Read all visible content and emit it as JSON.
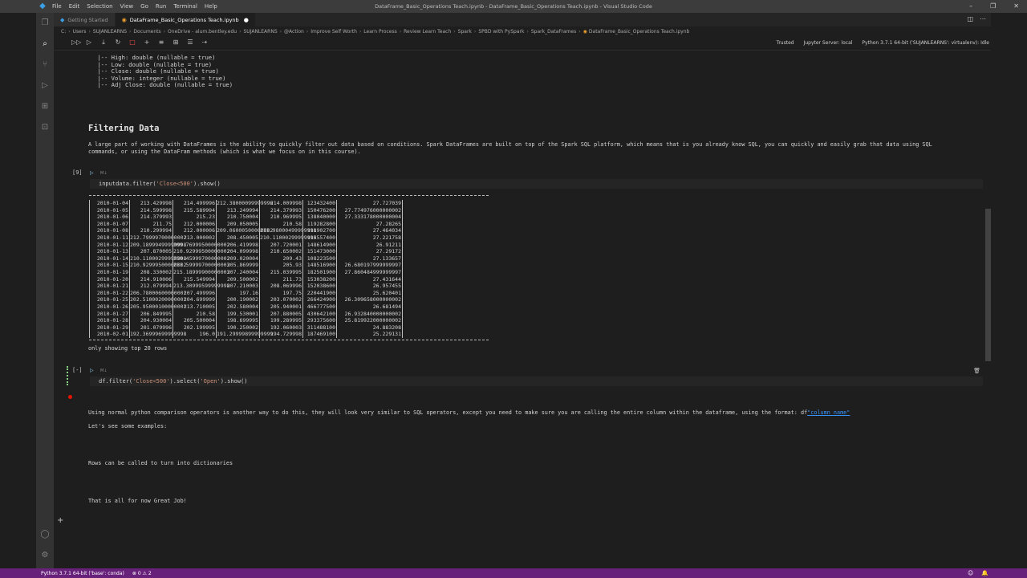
{
  "window": {
    "title": "DataFrame_Basic_Operations Teach.ipynb - DataFrame_Basic_Operations Teach.ipynb - Visual Studio Code",
    "menu": [
      "File",
      "Edit",
      "Selection",
      "View",
      "Go",
      "Run",
      "Terminal",
      "Help"
    ]
  },
  "tabs": [
    {
      "label": "Getting Started",
      "active": false
    },
    {
      "label": "DataFrame_Basic_Operations Teach.ipynb",
      "active": true,
      "dirty": "●"
    }
  ],
  "breadcrumb": [
    "C:",
    "Users",
    "SUJANLEARNS",
    "Documents",
    "OneDrive - alum.bentley.edu",
    "SUJANLEARNS",
    "@Action",
    "Improve Self Worth",
    "Learn Process",
    "Review Learn Teach",
    "Spark",
    "SPBD with PySpark",
    "Spark_DataFrames",
    "DataFrame_Basic_Operations Teach.ipynb"
  ],
  "toolbar": {
    "trusted": "Trusted",
    "jupyter_server": "Jupyter Server: local",
    "kernel": "Python 3.7.1 64-bit ('SUJANLEARNS': virtualenv): Idle"
  },
  "schema_lines": [
    " |-- High: double (nullable = true)",
    " |-- Low: double (nullable = true)",
    " |-- Close: double (nullable = true)",
    " |-- Volume: integer (nullable = true)",
    " |-- Adj Close: double (nullable = true)"
  ],
  "markdown1": {
    "heading": "Filtering Data",
    "line1": "A large part of working with DataFrames is the ability to quickly filter out data based on conditions. Spark DataFrames are built on top of the Spark SQL platform, which means that is you already know SQL, you can quickly and easily grab that data using SQL",
    "line2": "commands, or using the DataFram methods (which is what we focus on in this course)."
  },
  "cell1": {
    "count": "[9]",
    "lang": "M↓",
    "code_prefix": "inputdata.filter(",
    "code_str": "'Close<500'",
    "code_suffix": ").show()"
  },
  "output_rows": [
    [
      "2010-01-04",
      "213.429998",
      "214.499996",
      "212.38000099999996",
      "214.009998",
      "123432400",
      "27.727039"
    ],
    [
      "2010-01-05",
      "214.599998",
      "215.589994",
      "213.249994",
      "214.379993",
      "150476200",
      "27.774976000000002"
    ],
    [
      "2010-01-06",
      "214.379993",
      "215.23",
      "210.750004",
      "210.969995",
      "138040000",
      "27.333178000000004"
    ],
    [
      "2010-01-07",
      "211.75",
      "212.000006",
      "209.050005",
      "210.58",
      "119282800",
      "27.28265"
    ],
    [
      "2010-01-08",
      "210.299994",
      "212.000006",
      "209.06000500000002",
      "211.98000499999998",
      "111902700",
      "27.464034"
    ],
    [
      "2010-01-11",
      "212.79999700000002",
      "213.000002",
      "208.450005",
      "210.11000299999998",
      "115557400",
      "27.221758"
    ],
    [
      "2010-01-12",
      "209.18999499999998",
      "209.76999500000002",
      "206.419998",
      "207.720001",
      "148614900",
      "26.91211"
    ],
    [
      "2010-01-13",
      "207.870005",
      "210.92999500000002",
      "204.099998",
      "210.650002",
      "151473000",
      "27.29172"
    ],
    [
      "2010-01-14",
      "210.11000299999998",
      "210.45999700000002",
      "209.020004",
      "209.43",
      "108223500",
      "27.133657"
    ],
    [
      "2010-01-15",
      "210.92999500000002",
      "211.59999700000003",
      "205.869999",
      "205.93",
      "148516900",
      "26.680197999999997"
    ],
    [
      "2010-01-19",
      "208.330002",
      "215.18999900000003",
      "207.240004",
      "215.039995",
      "182501900",
      "27.860484999999997"
    ],
    [
      "2010-01-20",
      "214.910006",
      "215.549994",
      "209.500002",
      "211.73",
      "153038200",
      "27.431644"
    ],
    [
      "2010-01-21",
      "212.079994",
      "213.30999599999998",
      "207.210003",
      "208.069996",
      "152038600",
      "26.957455"
    ],
    [
      "2010-01-22",
      "206.78000600000001",
      "207.499996",
      "197.16",
      "197.75",
      "220441900",
      "25.620401"
    ],
    [
      "2010-01-25",
      "202.51000200000001",
      "204.699999",
      "200.190002",
      "203.070002",
      "266424900",
      "26.309658000000002"
    ],
    [
      "2010-01-26",
      "205.95000100000001",
      "213.710005",
      "202.580004",
      "205.940001",
      "466777500",
      "26.681494"
    ],
    [
      "2010-01-27",
      "206.849995",
      "210.58",
      "199.530001",
      "207.880005",
      "430642100",
      "26.932840000000002"
    ],
    [
      "2010-01-28",
      "204.930004",
      "205.500004",
      "198.699995",
      "199.289995",
      "293375600",
      "25.819922000000002"
    ],
    [
      "2010-01-29",
      "201.079996",
      "202.199995",
      "190.250002",
      "192.060003",
      "311488100",
      "24.883208"
    ],
    [
      "2010-02-01",
      "192.36999699999998",
      "196.0",
      "191.29999899999999",
      "194.729998",
      "187469100",
      "25.229131"
    ]
  ],
  "only_showing": "only showing top 20 rows",
  "cell2": {
    "count": "[-]",
    "lang": "M↓",
    "code_prefix": "df.filter(",
    "code_str1": "'Close<500'",
    "code_mid": ").select(",
    "code_str2": "'Open'",
    "code_suffix": ").show()"
  },
  "markdown2": {
    "text": "Using normal python comparison operators is another way to do this, they will look very similar to SQL operators, except you need to make sure you are calling the entire column within the dataframe, using the format: df",
    "link": "\"column name\"",
    "examples": "Let's see some examples:",
    "rows_dict": "Rows can be called to turn into dictionaries",
    "done": "That is all for now Great Job!"
  },
  "statusbar": {
    "interpreter": "Python 3.7.1 64-bit ('base': conda)",
    "problems": "⊗ 0 ⚠ 2"
  }
}
